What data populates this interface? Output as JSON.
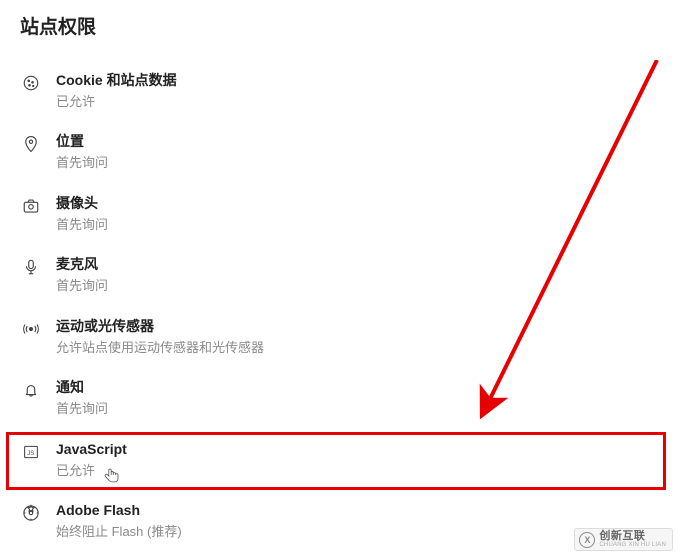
{
  "section_title": "站点权限",
  "items": [
    {
      "label": "Cookie 和站点数据",
      "sub": "已允许"
    },
    {
      "label": "位置",
      "sub": "首先询问"
    },
    {
      "label": "摄像头",
      "sub": "首先询问"
    },
    {
      "label": "麦克风",
      "sub": "首先询问"
    },
    {
      "label": "运动或光传感器",
      "sub": "允许站点使用运动传感器和光传感器"
    },
    {
      "label": "通知",
      "sub": "首先询问"
    },
    {
      "label": "JavaScript",
      "sub": "已允许"
    },
    {
      "label": "Adobe Flash",
      "sub": "始终阻止 Flash (推荐)"
    }
  ],
  "watermark": {
    "main": "创新互联",
    "sub": "CHUANG XIN HU LIAN",
    "logo": "X"
  },
  "annotation": {
    "highlight_index": 6,
    "arrow_color": "#e60000"
  }
}
